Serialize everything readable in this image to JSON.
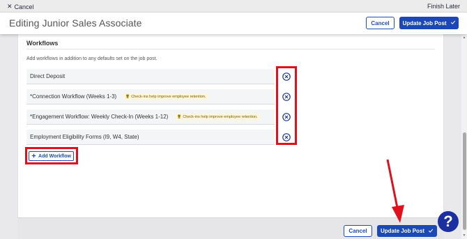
{
  "topbar": {
    "cancel_label": "Cancel",
    "finish_label": "Finish Later"
  },
  "header": {
    "title": "Editing Junior Sales Associate",
    "cancel_label": "Cancel",
    "update_label": "Update Job Post"
  },
  "workflows": {
    "title": "Workflows",
    "description": "Add workflows in addition to any defaults set on the job post.",
    "items": [
      {
        "label": "Direct Deposit",
        "tip": ""
      },
      {
        "label": "*Connection Workflow (Weeks 1-3)",
        "tip": "Check-ins help improve employee retention."
      },
      {
        "label": "*Engagement Workflow: Weekly Check-In (Weeks 1-12)",
        "tip": "Check-ins help improve employee retention."
      },
      {
        "label": "Employment Eligibility Forms (I9, W4, State)",
        "tip": ""
      }
    ],
    "add_label": "Add Workflow"
  },
  "footer": {
    "cancel_label": "Cancel",
    "update_label": "Update Job Post"
  },
  "help": {
    "label": "?"
  },
  "colors": {
    "accent": "#1c47b8",
    "annotation": "#e0101d",
    "help": "#1c2fa0"
  },
  "icons": [
    "close-icon",
    "remove-circle-icon",
    "trophy-icon",
    "plus-icon",
    "check-icon",
    "question-icon"
  ]
}
